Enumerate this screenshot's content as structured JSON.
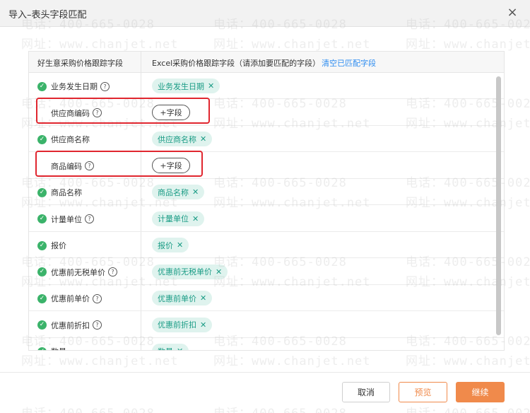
{
  "dialog": {
    "title": "导入–表头字段匹配",
    "close_symbol": "×"
  },
  "table": {
    "left_header": "好生意采购价格跟踪字段",
    "right_header": "Excel采购价格跟踪字段（请添加要匹配的字段）",
    "clear_link": "清空已匹配字段",
    "rows": [
      {
        "label": "业务发生日期",
        "matched": true,
        "help": true,
        "tag": "业务发生日期"
      },
      {
        "label": "供应商编码",
        "matched": false,
        "help": true,
        "tag": null,
        "add_label": "+字段"
      },
      {
        "label": "供应商名称",
        "matched": true,
        "help": false,
        "tag": "供应商名称"
      },
      {
        "label": "商品编码",
        "matched": false,
        "help": true,
        "tag": null,
        "add_label": "+字段"
      },
      {
        "label": "商品名称",
        "matched": true,
        "help": false,
        "tag": "商品名称"
      },
      {
        "label": "计量单位",
        "matched": true,
        "help": true,
        "tag": "计量单位"
      },
      {
        "label": "报价",
        "matched": true,
        "help": false,
        "tag": "报价"
      },
      {
        "label": "优惠前无税单价",
        "matched": true,
        "help": true,
        "tag": "优惠前无税单价"
      },
      {
        "label": "优惠前单价",
        "matched": true,
        "help": true,
        "tag": "优惠前单价"
      },
      {
        "label": "优惠前折扣",
        "matched": true,
        "help": true,
        "tag": "优惠前折扣"
      },
      {
        "label": "数量",
        "matched": true,
        "help": false,
        "tag": "数量"
      }
    ]
  },
  "icons": {
    "check": "✓",
    "help": "?",
    "remove": "✕"
  },
  "footer": {
    "cancel_label": "取消",
    "preview_label": "预览",
    "continue_label": "继续"
  },
  "watermark": {
    "phone": "电话：400-665-0028",
    "site": "网址：www.chanjet.net"
  },
  "colors": {
    "accent": "#f08a4b",
    "success": "#3bb36a",
    "tag_bg": "#dff3ee",
    "tag_text": "#1a9c85",
    "link": "#2d8cf0",
    "highlight": "#e0262f"
  }
}
